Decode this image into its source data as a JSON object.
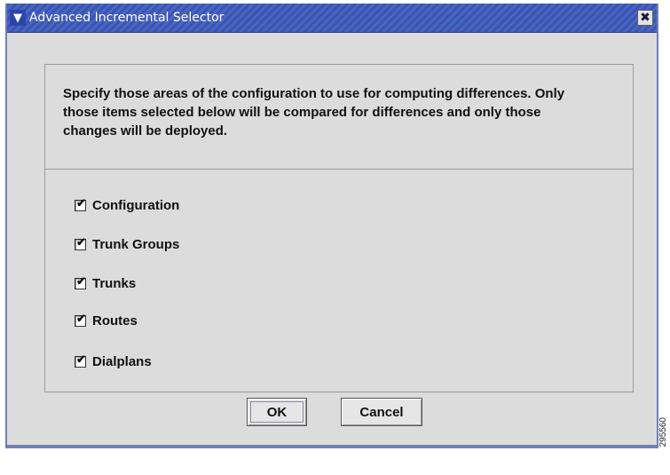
{
  "window": {
    "title": "Advanced Incremental Selector",
    "menu_icon": "chevron-down-icon",
    "close_icon": "close-icon"
  },
  "description": "Specify those areas of the configuration to use for computing differences.  Only those items selected below will be compared for differences and only those changes will be deployed.",
  "options": [
    {
      "label": "Configuration",
      "checked": true
    },
    {
      "label": "Trunk Groups",
      "checked": true
    },
    {
      "label": "Trunks",
      "checked": true
    },
    {
      "label": "Routes",
      "checked": true
    },
    {
      "label": "Dialplans",
      "checked": true
    }
  ],
  "buttons": {
    "ok": "OK",
    "cancel": "Cancel"
  },
  "figure_id": "295560",
  "colors": {
    "titlebar": "#3a55b0",
    "dialog_bg": "#dcdcdc",
    "border": "#6f7fb8"
  }
}
